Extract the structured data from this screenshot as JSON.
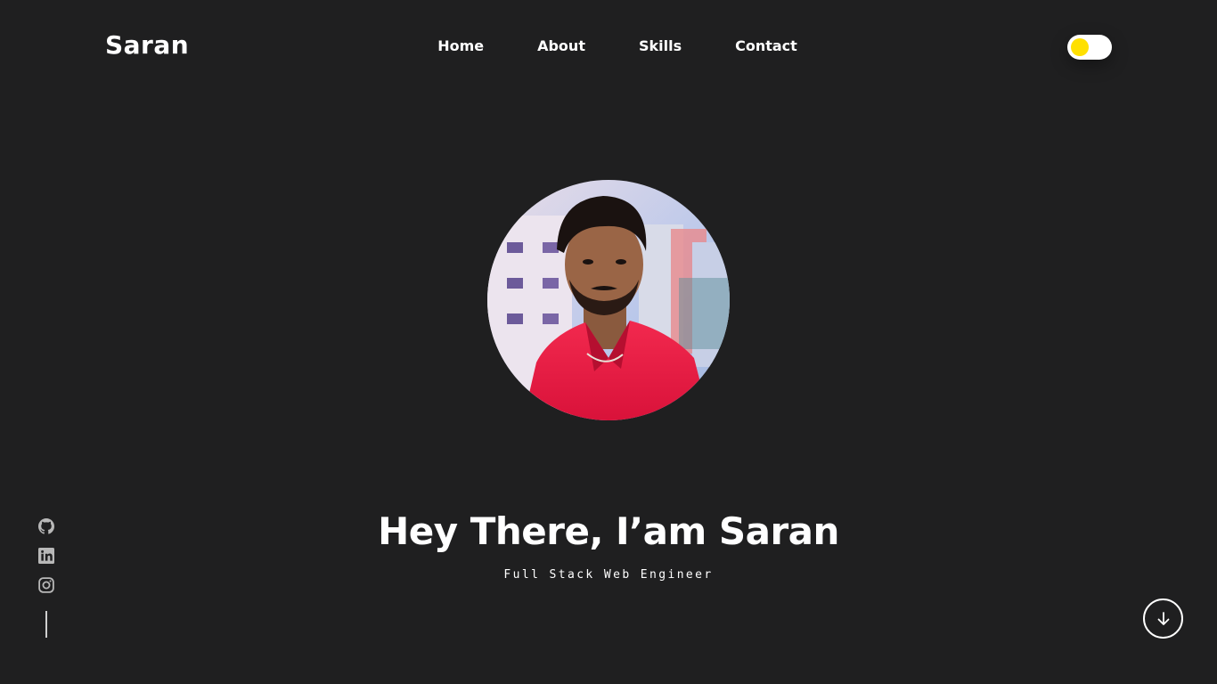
{
  "header": {
    "logo": "Saran",
    "nav": [
      "Home",
      "About",
      "Skills",
      "Contact"
    ],
    "theme_toggle": {
      "state": "dark",
      "knob_color": "#ffe000"
    }
  },
  "hero": {
    "title": "Hey There, I’am Saran",
    "subtitle": "Full Stack Web Engineer"
  },
  "social": {
    "icons": [
      "github-icon",
      "linkedin-icon",
      "instagram-icon"
    ]
  },
  "colors": {
    "background": "#1f1f20",
    "text": "#ffffff",
    "accent": "#ffe000"
  }
}
